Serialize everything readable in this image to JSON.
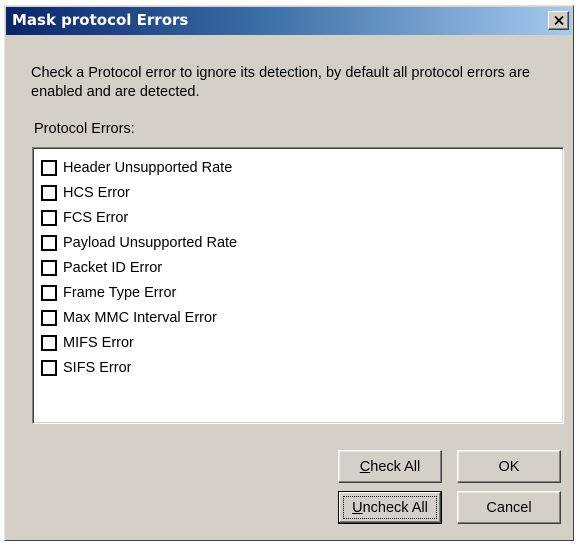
{
  "window": {
    "title": "Mask protocol Errors"
  },
  "instructions": {
    "line1": "Check a Protocol error to ignore its detection, by default all protocol errors are",
    "line2": "enabled and are detected."
  },
  "protocol_errors": {
    "label": "Protocol Errors:",
    "items": [
      {
        "label": "Header Unsupported Rate",
        "checked": false
      },
      {
        "label": "HCS Error",
        "checked": false
      },
      {
        "label": "FCS Error",
        "checked": false
      },
      {
        "label": "Payload Unsupported Rate",
        "checked": false
      },
      {
        "label": "Packet ID Error",
        "checked": false
      },
      {
        "label": "Frame Type Error",
        "checked": false
      },
      {
        "label": "Max MMC Interval Error",
        "checked": false
      },
      {
        "label": "MIFS Error",
        "checked": false
      },
      {
        "label": "SIFS Error",
        "checked": false
      }
    ]
  },
  "buttons": {
    "check_all": {
      "mnemonic": "C",
      "rest": "heck All"
    },
    "uncheck_all": {
      "mnemonic": "U",
      "rest": "ncheck All"
    },
    "ok": "OK",
    "cancel": "Cancel"
  },
  "icons": {
    "close": "close-icon"
  },
  "colors": {
    "titlebar_start": "#0a246a",
    "titlebar_end": "#a6caf0",
    "dialog_face": "#d4d0c8"
  }
}
